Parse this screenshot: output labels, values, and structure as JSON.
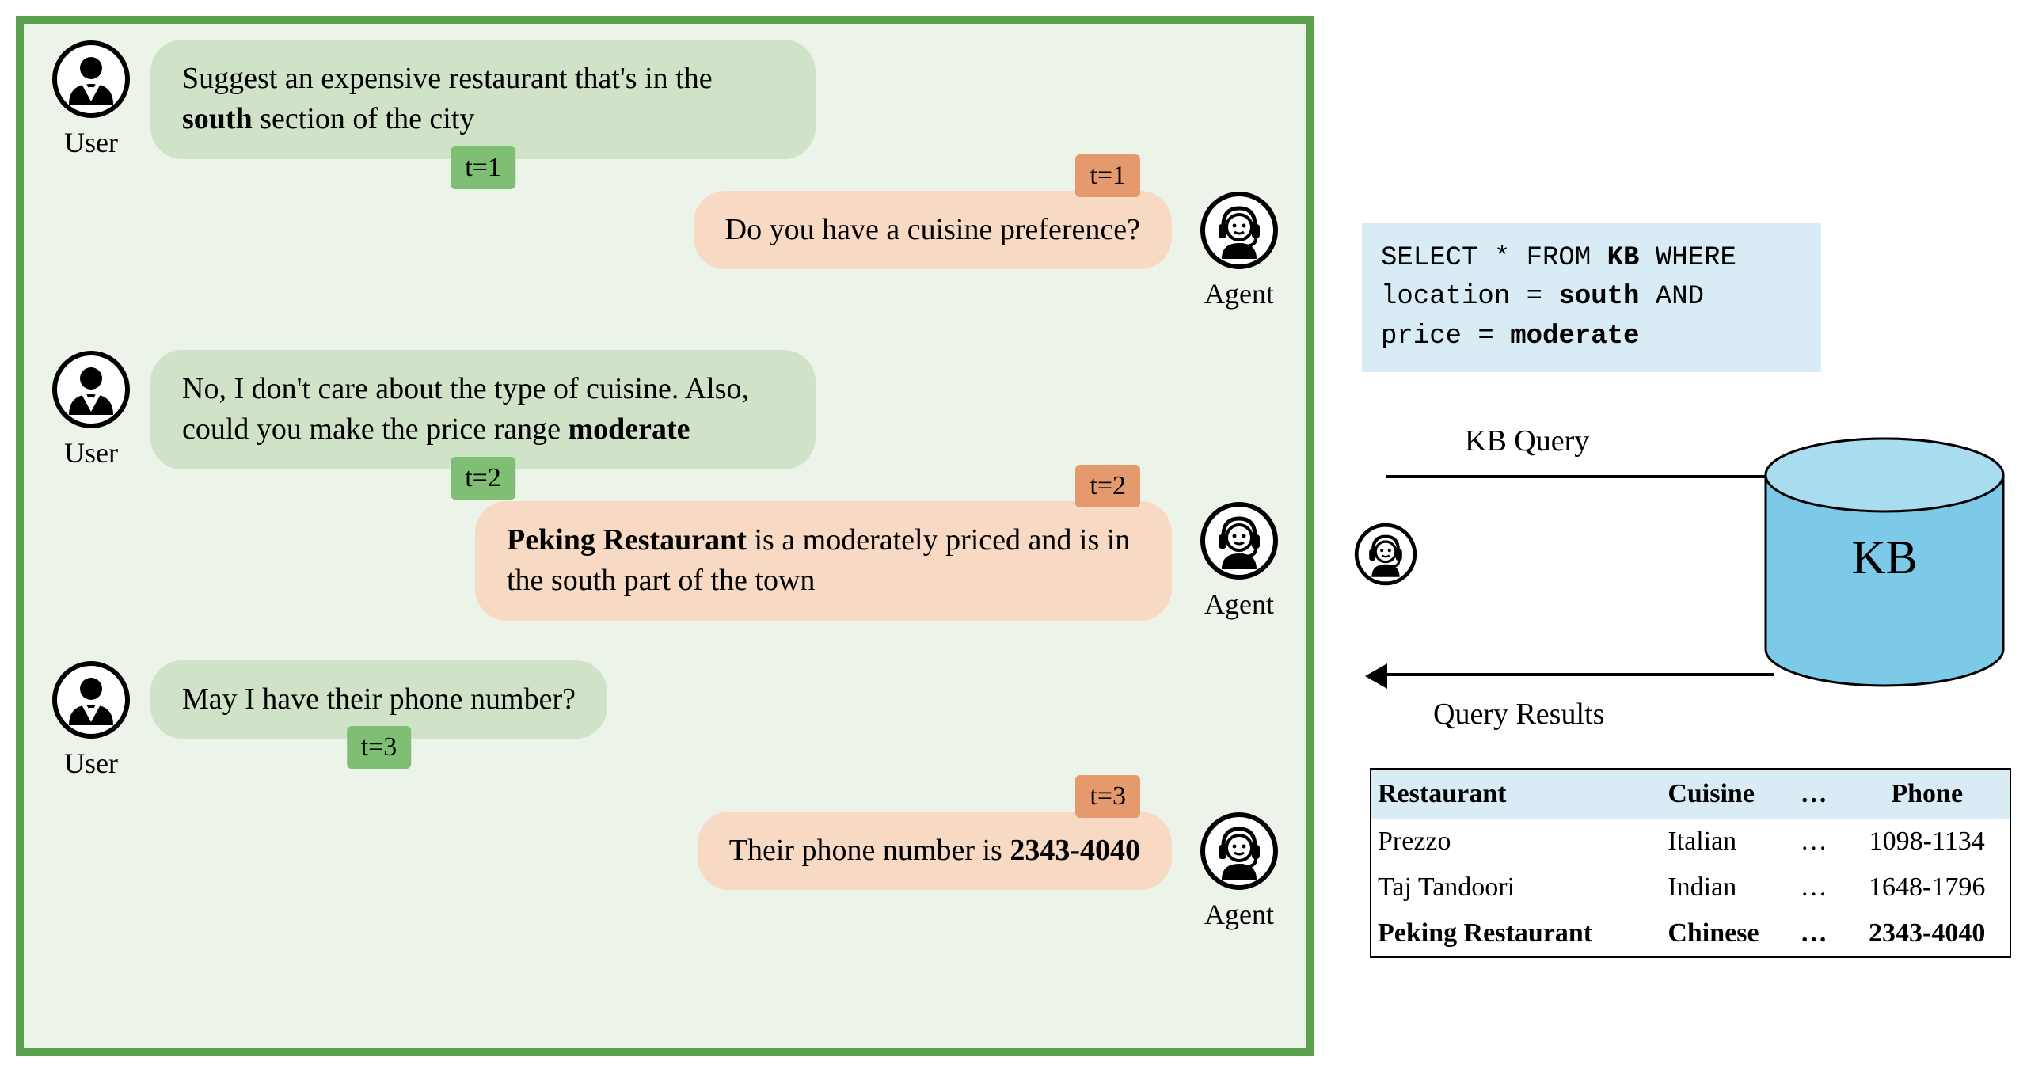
{
  "labels": {
    "user": "User",
    "agent": "Agent"
  },
  "dialogue": [
    {
      "user": {
        "pre": "Suggest an expensive  restaurant that's in the ",
        "bold": "south",
        "post": " section of the city",
        "t": "t=1"
      },
      "agent": {
        "pre": "Do you have a cuisine preference?",
        "bold": "",
        "post": "",
        "t": "t=1"
      }
    },
    {
      "user": {
        "pre": "No, I don't care about the type of cuisine. Also,  could you make the price range ",
        "bold": "moderate",
        "post": "",
        "t": "t=2"
      },
      "agent": {
        "pre": "",
        "bold": "Peking Restaurant",
        "post": " is a moderately priced and is in the south part of the town",
        "t": "t=2"
      }
    },
    {
      "user": {
        "pre": "May I have their phone number?",
        "bold": "",
        "post": "",
        "t": "t=3"
      },
      "agent": {
        "pre": "Their phone number is ",
        "bold": "2343-4040",
        "post": "",
        "t": "t=3"
      }
    }
  ],
  "sql": {
    "l1a": "SELECT * FROM ",
    "l1b": "KB",
    "l1c": " WHERE",
    "l2a": "location  = ",
    "l2b": "south",
    "l2c": " AND",
    "l3a": "price = ",
    "l3b": "moderate",
    "l3c": ""
  },
  "kb": {
    "label": "KB",
    "query_label": "KB Query",
    "results_label": "Query Results"
  },
  "table": {
    "headers": [
      "Restaurant",
      "Cuisine",
      "…",
      "Phone"
    ],
    "rows": [
      {
        "cells": [
          "Prezzo",
          "Italian",
          "…",
          "1098-1134"
        ],
        "bold": false
      },
      {
        "cells": [
          "Taj Tandoori",
          "Indian",
          "…",
          "1648-1796"
        ],
        "bold": false
      },
      {
        "cells": [
          "Peking Restaurant",
          "Chinese",
          "…",
          "2343-4040"
        ],
        "bold": true
      }
    ]
  }
}
